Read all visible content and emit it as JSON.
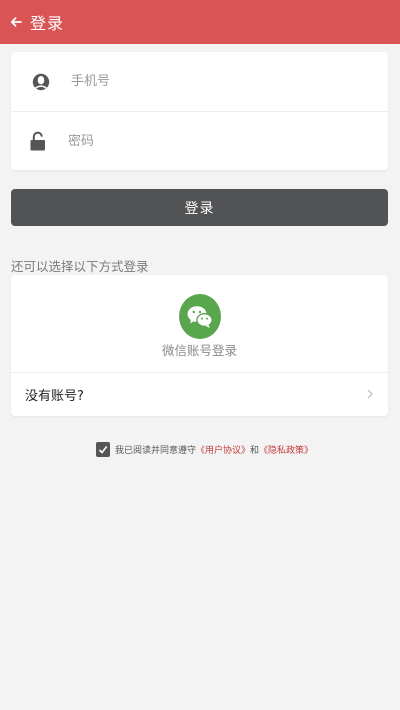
{
  "header": {
    "title": "登录",
    "back_icon": "arrow-left-icon",
    "color": "#d95454"
  },
  "form": {
    "phone": {
      "placeholder": "手机号",
      "value": "",
      "icon": "user-icon"
    },
    "password": {
      "placeholder": "密码",
      "value": "",
      "icon": "unlock-icon"
    }
  },
  "login_button": {
    "label": "登录",
    "color": "#525355"
  },
  "alt_login": {
    "label": "还可以选择以下方式登录",
    "wechat": {
      "label": "微信账号登录",
      "icon": "wechat-icon",
      "color": "#5aa64e"
    },
    "no_account": {
      "label": "没有账号?",
      "icon": "chevron-right-icon"
    }
  },
  "agreement": {
    "checked": true,
    "prefix": "我已阅读并同意遵守",
    "user_agreement": "《用户协议》",
    "and": "和",
    "privacy_policy": "《隐私政策》",
    "link_color": "#c63a3a"
  }
}
